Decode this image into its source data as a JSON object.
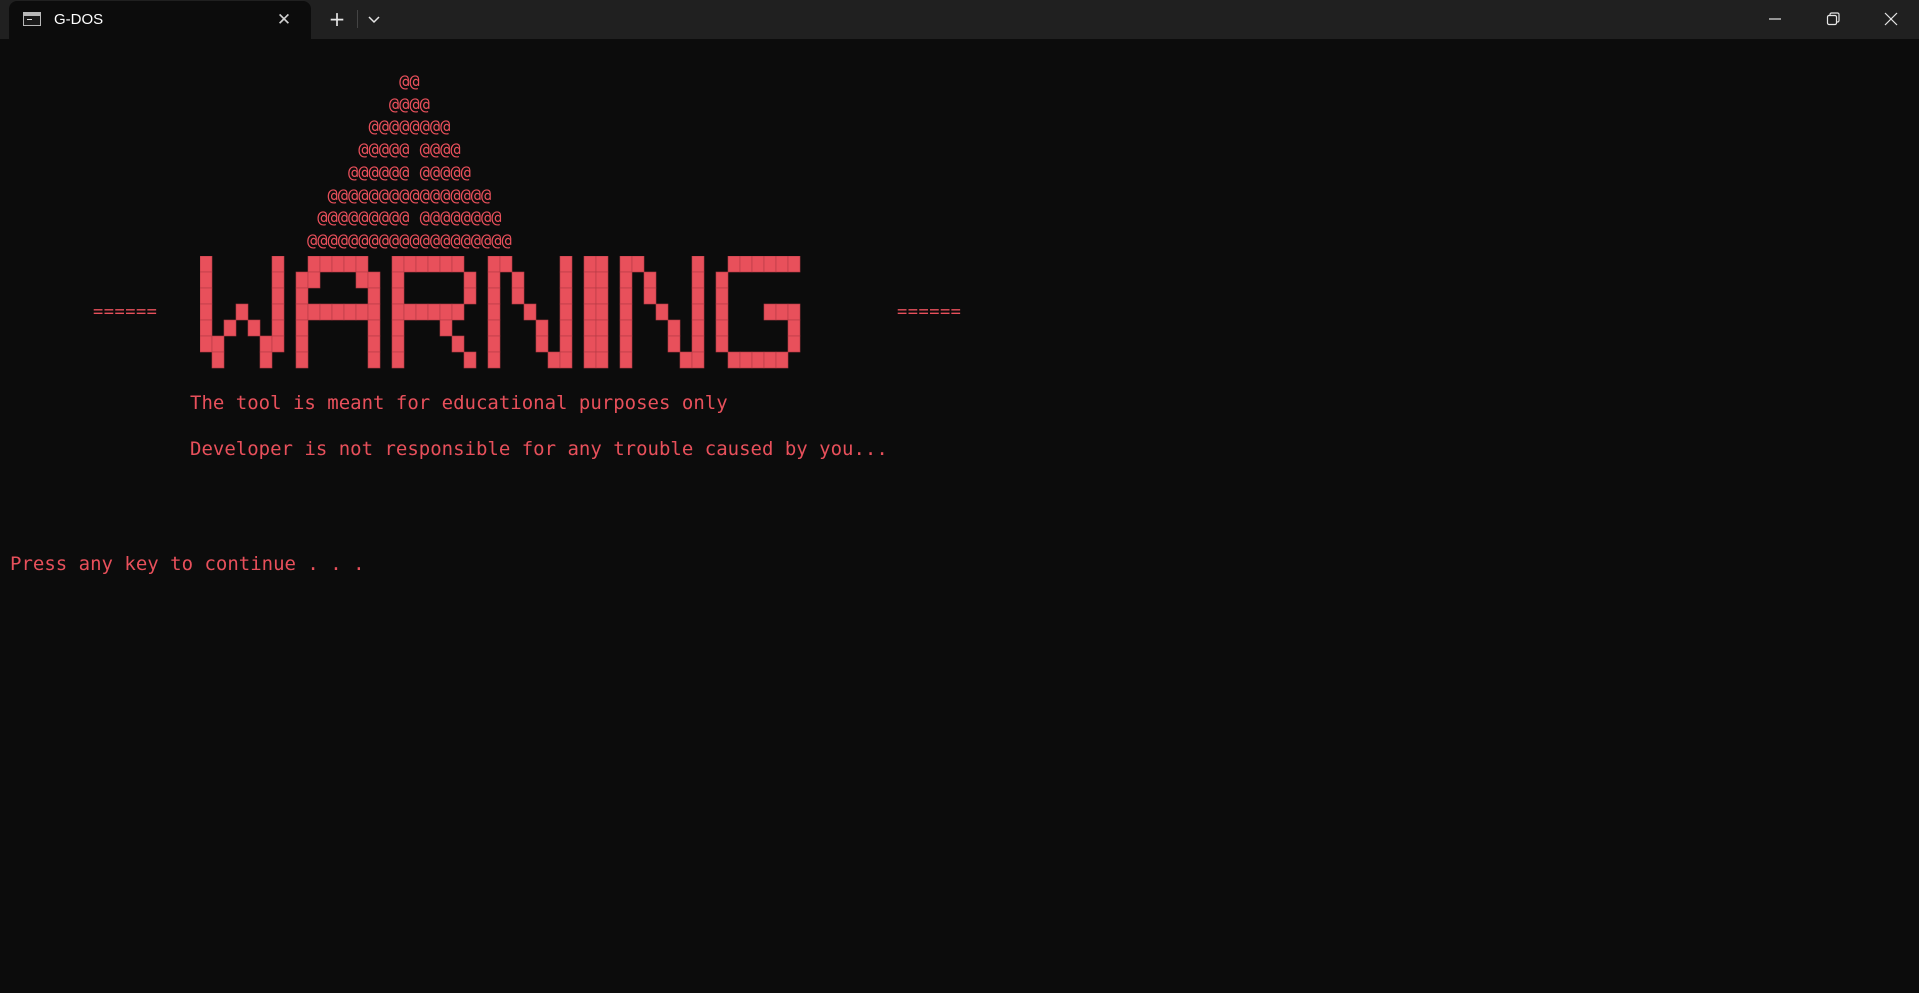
{
  "window": {
    "tab_title": "G-DOS",
    "tab_icon": "terminal-icon",
    "new_tab_label": "+",
    "controls": [
      "minimize-icon",
      "restore-icon",
      "close-icon"
    ]
  },
  "terminal": {
    "text_color": "#e8505b",
    "background": "#0c0c0c",
    "triangle_lines": [
      "                                       @@",
      "                                      @@@@",
      "                                    @@@@@@@@",
      "                                   @@@@@ @@@@",
      "                                  @@@@@@ @@@@@",
      "                                @@@@@@@@@@@@@@@@",
      "                               @@@@@@@@@ @@@@@@@@",
      "                              @@@@@@@@@@@@@@@@@@@@"
    ],
    "banner_word": "WARNING",
    "banner_left_trim": "======",
    "banner_right_trim": "======",
    "message_1": "The tool is meant for educational purposes only",
    "message_2": "Developer is not responsible for any trouble caused by you...",
    "prompt": "Press any key to continue . . ."
  }
}
